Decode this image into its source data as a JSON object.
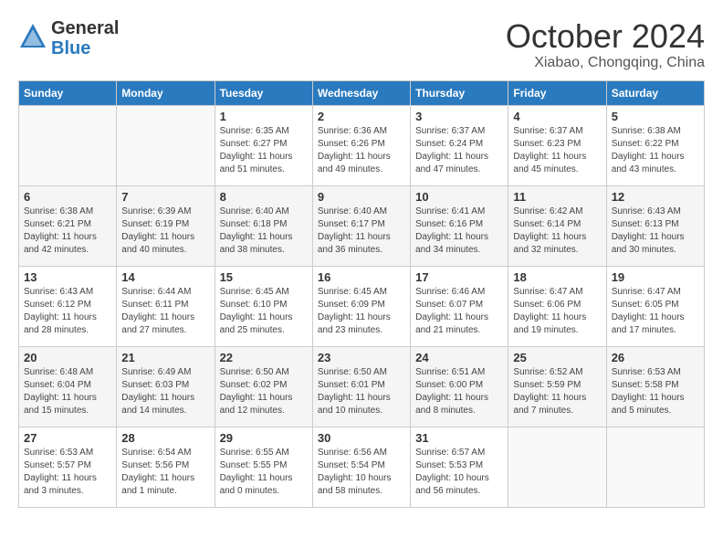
{
  "header": {
    "logo_general": "General",
    "logo_blue": "Blue",
    "month": "October 2024",
    "location": "Xiabao, Chongqing, China"
  },
  "weekdays": [
    "Sunday",
    "Monday",
    "Tuesday",
    "Wednesday",
    "Thursday",
    "Friday",
    "Saturday"
  ],
  "weeks": [
    [
      {
        "day": "",
        "info": ""
      },
      {
        "day": "",
        "info": ""
      },
      {
        "day": "1",
        "info": "Sunrise: 6:35 AM\nSunset: 6:27 PM\nDaylight: 11 hours and 51 minutes."
      },
      {
        "day": "2",
        "info": "Sunrise: 6:36 AM\nSunset: 6:26 PM\nDaylight: 11 hours and 49 minutes."
      },
      {
        "day": "3",
        "info": "Sunrise: 6:37 AM\nSunset: 6:24 PM\nDaylight: 11 hours and 47 minutes."
      },
      {
        "day": "4",
        "info": "Sunrise: 6:37 AM\nSunset: 6:23 PM\nDaylight: 11 hours and 45 minutes."
      },
      {
        "day": "5",
        "info": "Sunrise: 6:38 AM\nSunset: 6:22 PM\nDaylight: 11 hours and 43 minutes."
      }
    ],
    [
      {
        "day": "6",
        "info": "Sunrise: 6:38 AM\nSunset: 6:21 PM\nDaylight: 11 hours and 42 minutes."
      },
      {
        "day": "7",
        "info": "Sunrise: 6:39 AM\nSunset: 6:19 PM\nDaylight: 11 hours and 40 minutes."
      },
      {
        "day": "8",
        "info": "Sunrise: 6:40 AM\nSunset: 6:18 PM\nDaylight: 11 hours and 38 minutes."
      },
      {
        "day": "9",
        "info": "Sunrise: 6:40 AM\nSunset: 6:17 PM\nDaylight: 11 hours and 36 minutes."
      },
      {
        "day": "10",
        "info": "Sunrise: 6:41 AM\nSunset: 6:16 PM\nDaylight: 11 hours and 34 minutes."
      },
      {
        "day": "11",
        "info": "Sunrise: 6:42 AM\nSunset: 6:14 PM\nDaylight: 11 hours and 32 minutes."
      },
      {
        "day": "12",
        "info": "Sunrise: 6:43 AM\nSunset: 6:13 PM\nDaylight: 11 hours and 30 minutes."
      }
    ],
    [
      {
        "day": "13",
        "info": "Sunrise: 6:43 AM\nSunset: 6:12 PM\nDaylight: 11 hours and 28 minutes."
      },
      {
        "day": "14",
        "info": "Sunrise: 6:44 AM\nSunset: 6:11 PM\nDaylight: 11 hours and 27 minutes."
      },
      {
        "day": "15",
        "info": "Sunrise: 6:45 AM\nSunset: 6:10 PM\nDaylight: 11 hours and 25 minutes."
      },
      {
        "day": "16",
        "info": "Sunrise: 6:45 AM\nSunset: 6:09 PM\nDaylight: 11 hours and 23 minutes."
      },
      {
        "day": "17",
        "info": "Sunrise: 6:46 AM\nSunset: 6:07 PM\nDaylight: 11 hours and 21 minutes."
      },
      {
        "day": "18",
        "info": "Sunrise: 6:47 AM\nSunset: 6:06 PM\nDaylight: 11 hours and 19 minutes."
      },
      {
        "day": "19",
        "info": "Sunrise: 6:47 AM\nSunset: 6:05 PM\nDaylight: 11 hours and 17 minutes."
      }
    ],
    [
      {
        "day": "20",
        "info": "Sunrise: 6:48 AM\nSunset: 6:04 PM\nDaylight: 11 hours and 15 minutes."
      },
      {
        "day": "21",
        "info": "Sunrise: 6:49 AM\nSunset: 6:03 PM\nDaylight: 11 hours and 14 minutes."
      },
      {
        "day": "22",
        "info": "Sunrise: 6:50 AM\nSunset: 6:02 PM\nDaylight: 11 hours and 12 minutes."
      },
      {
        "day": "23",
        "info": "Sunrise: 6:50 AM\nSunset: 6:01 PM\nDaylight: 11 hours and 10 minutes."
      },
      {
        "day": "24",
        "info": "Sunrise: 6:51 AM\nSunset: 6:00 PM\nDaylight: 11 hours and 8 minutes."
      },
      {
        "day": "25",
        "info": "Sunrise: 6:52 AM\nSunset: 5:59 PM\nDaylight: 11 hours and 7 minutes."
      },
      {
        "day": "26",
        "info": "Sunrise: 6:53 AM\nSunset: 5:58 PM\nDaylight: 11 hours and 5 minutes."
      }
    ],
    [
      {
        "day": "27",
        "info": "Sunrise: 6:53 AM\nSunset: 5:57 PM\nDaylight: 11 hours and 3 minutes."
      },
      {
        "day": "28",
        "info": "Sunrise: 6:54 AM\nSunset: 5:56 PM\nDaylight: 11 hours and 1 minute."
      },
      {
        "day": "29",
        "info": "Sunrise: 6:55 AM\nSunset: 5:55 PM\nDaylight: 11 hours and 0 minutes."
      },
      {
        "day": "30",
        "info": "Sunrise: 6:56 AM\nSunset: 5:54 PM\nDaylight: 10 hours and 58 minutes."
      },
      {
        "day": "31",
        "info": "Sunrise: 6:57 AM\nSunset: 5:53 PM\nDaylight: 10 hours and 56 minutes."
      },
      {
        "day": "",
        "info": ""
      },
      {
        "day": "",
        "info": ""
      }
    ]
  ]
}
